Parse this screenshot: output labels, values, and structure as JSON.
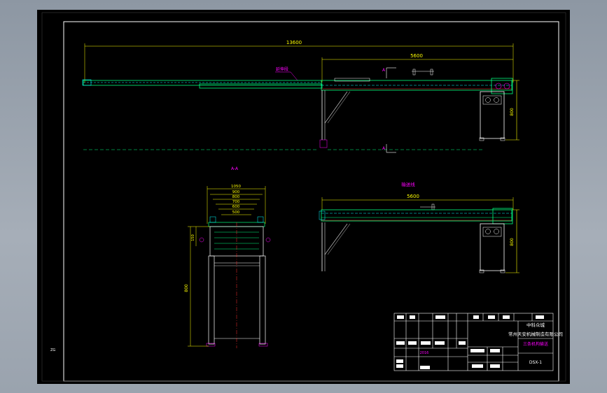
{
  "drawing": {
    "top_view_overall_dim": "13600",
    "top_view_frame_dim": "5600",
    "top_view_height_dim": "800",
    "section_mark_top": "A",
    "section_mark_bottom": "A",
    "extension_label": "延伸段",
    "section_title": "A-A",
    "section_widths": [
      "1050",
      "900",
      "800",
      "700",
      "600",
      "500"
    ],
    "section_height_dim": "800",
    "section_side_dim": "150",
    "front_title": "输送线",
    "front_length_dim": "5600",
    "front_height_dim": "800",
    "corner_mark": "ZG"
  },
  "title_block": {
    "company_line1": "中科众城",
    "company_line2": "常州天安机械制造有限公司",
    "drawing_name": "三条机构输送",
    "drawing_number": "DSX-1",
    "design_value": "2016"
  },
  "colors": {
    "cad_background": "#000000",
    "frame_line": "#ffffff",
    "dimension": "#ffff00",
    "conveyor": "#00ff7f",
    "belt": "#00ffff",
    "accent": "#ff00ff",
    "centerline": "#ff3030"
  }
}
